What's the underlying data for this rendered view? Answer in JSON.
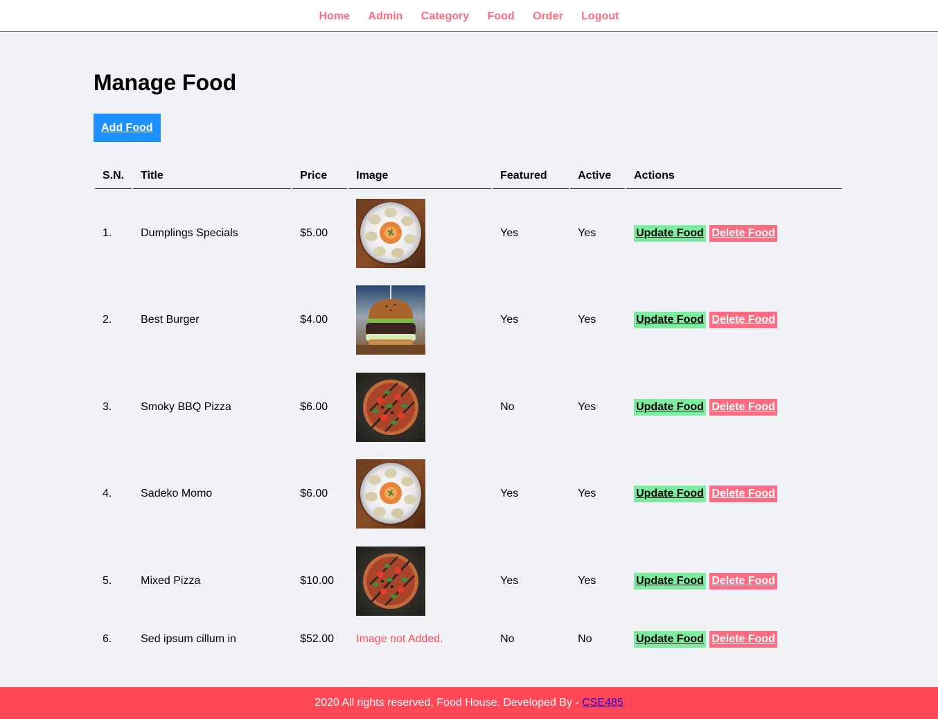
{
  "nav": {
    "items": [
      "Home",
      "Admin",
      "Category",
      "Food",
      "Order",
      "Logout"
    ]
  },
  "main": {
    "title": "Manage Food",
    "add_button": "Add Food",
    "table": {
      "headers": [
        "S.N.",
        "Title",
        "Price",
        "Image",
        "Featured",
        "Active",
        "Actions"
      ],
      "rows": [
        {
          "sn": "1.",
          "title": "Dumplings Specials",
          "price": "$5.00",
          "image": "momo",
          "featured": "Yes",
          "active": "Yes"
        },
        {
          "sn": "2.",
          "title": "Best Burger",
          "price": "$4.00",
          "image": "burger",
          "featured": "Yes",
          "active": "Yes"
        },
        {
          "sn": "3.",
          "title": "Smoky BBQ Pizza",
          "price": "$6.00",
          "image": "pizza",
          "featured": "No",
          "active": "Yes"
        },
        {
          "sn": "4.",
          "title": "Sadeko Momo",
          "price": "$6.00",
          "image": "momo",
          "featured": "Yes",
          "active": "Yes"
        },
        {
          "sn": "5.",
          "title": "Mixed Pizza",
          "price": "$10.00",
          "image": "pizza",
          "featured": "Yes",
          "active": "Yes"
        },
        {
          "sn": "6.",
          "title": "Sed ipsum cillum in",
          "price": "$52.00",
          "image": null,
          "image_text": "Image not Added.",
          "featured": "No",
          "active": "No"
        }
      ],
      "update_label": "Update Food",
      "delete_label": "Delete Food"
    }
  },
  "footer": {
    "text": "2020 All rights reserved, Food House. Developed By - ",
    "link": "CSE485"
  },
  "colors": {
    "accent": "#ff6b81",
    "primary": "#1e90ff",
    "success": "#7bed9f",
    "danger": "#ff4757",
    "background": "#f1f2f6"
  }
}
